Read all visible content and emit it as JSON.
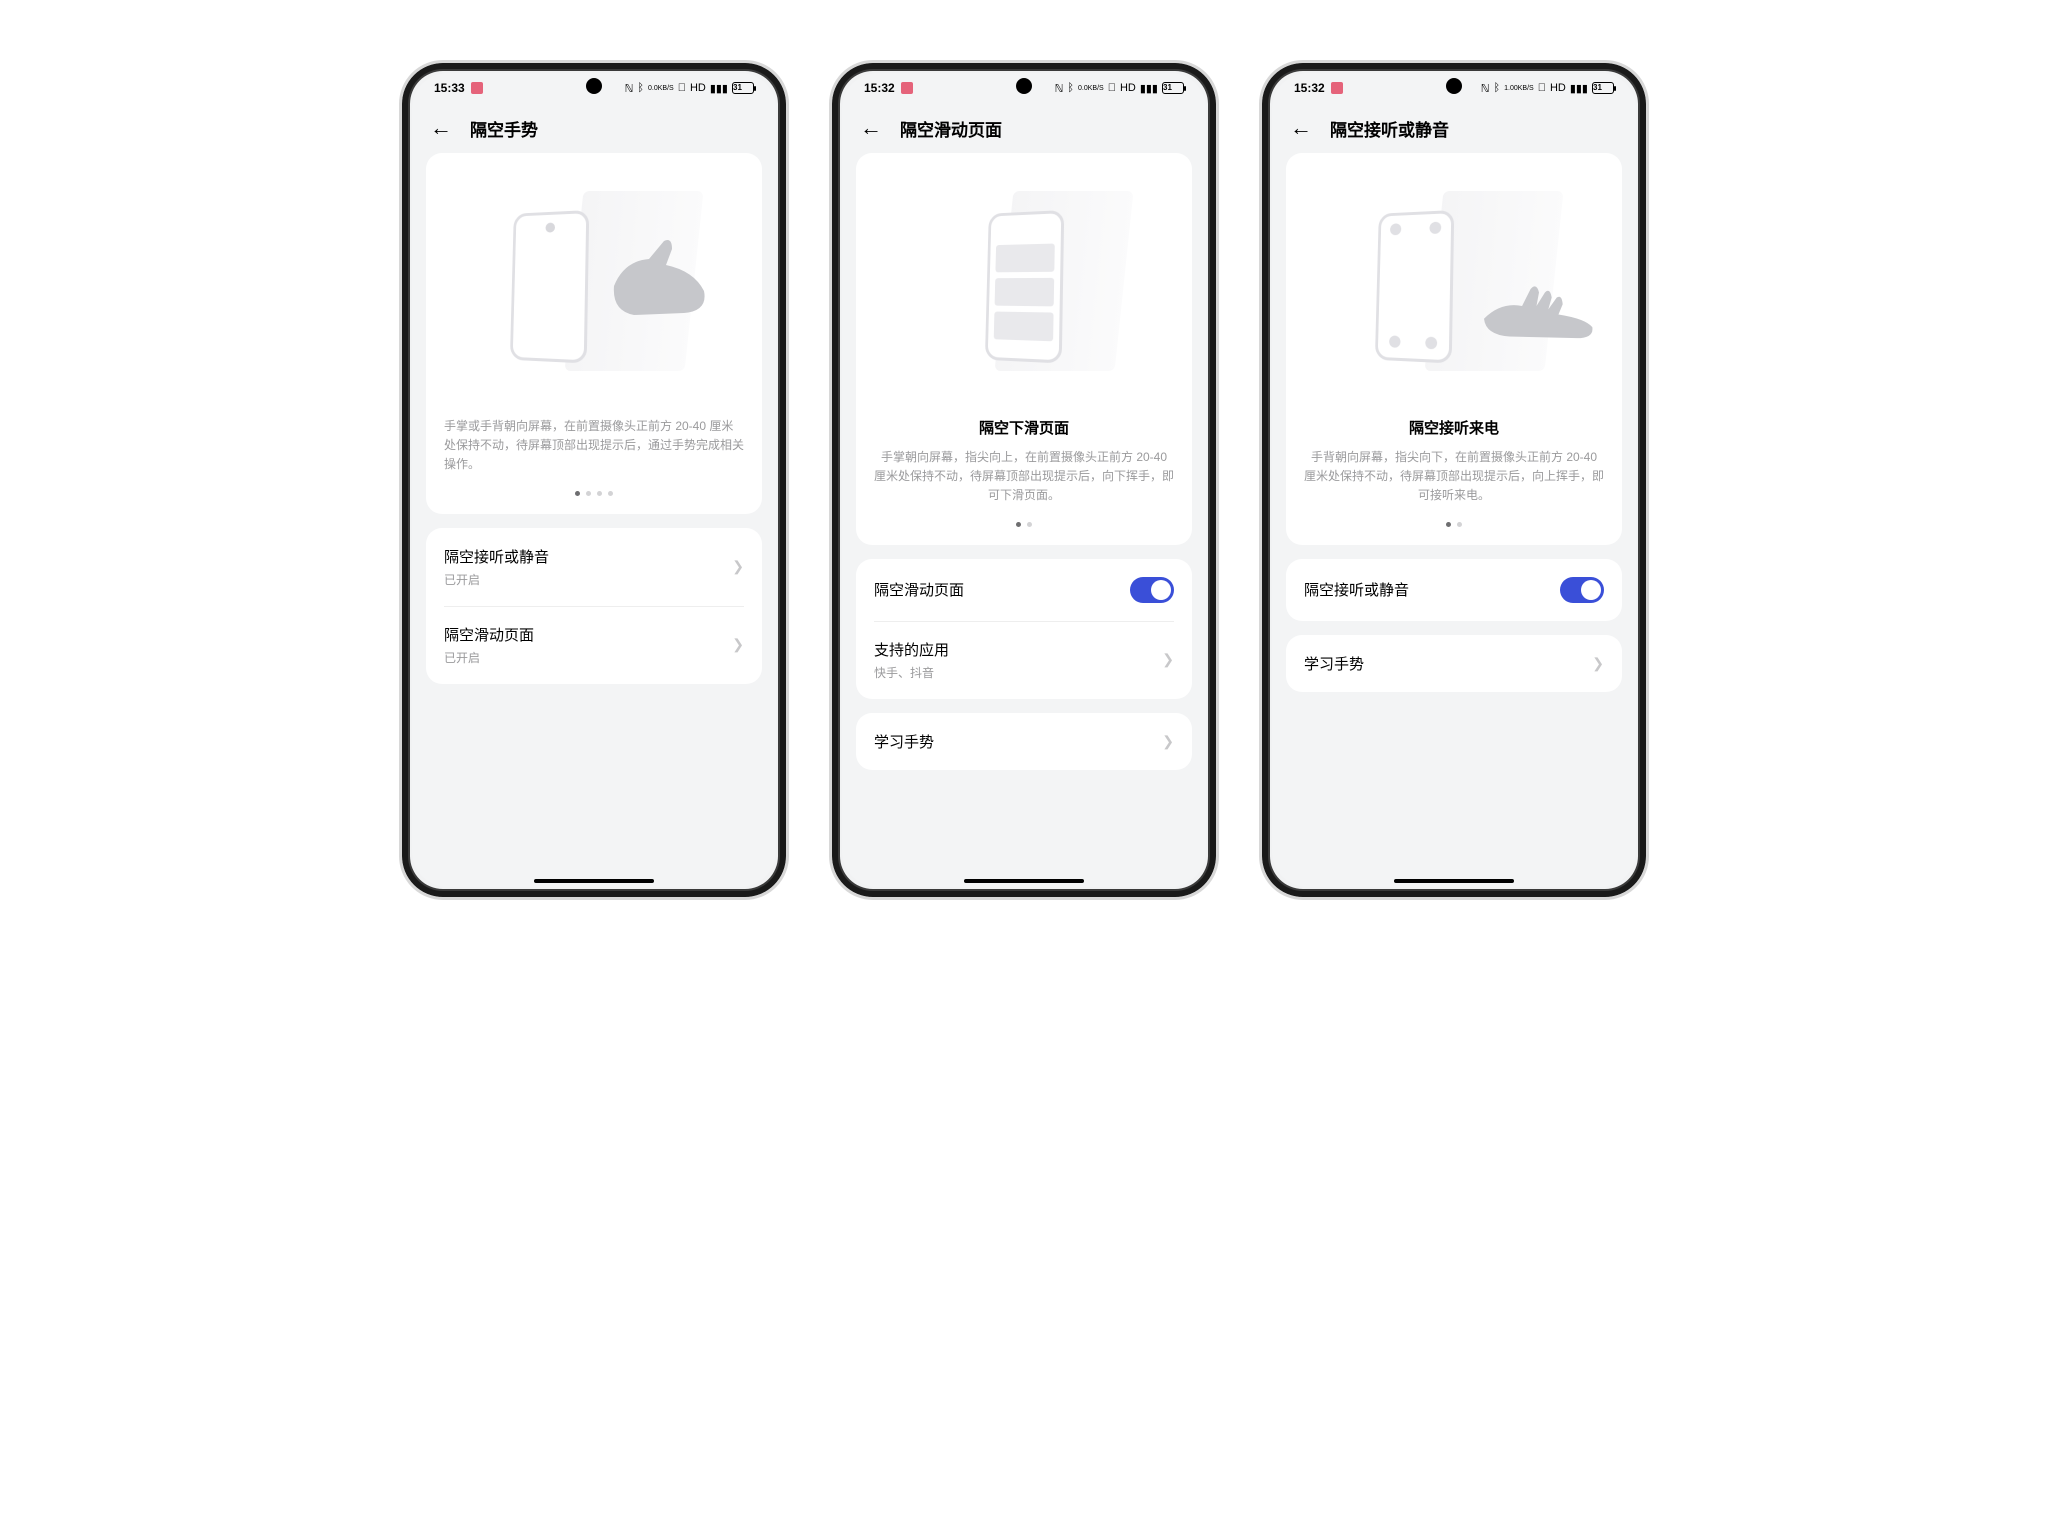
{
  "status": {
    "time1": "15:33",
    "time2": "15:32",
    "time3": "15:32",
    "kbs": "0.0",
    "kbs_unit": "KB/S",
    "battery": "31"
  },
  "phone1": {
    "title": "隔空手势",
    "illus_desc": "手掌或手背朝向屏幕，在前置摄像头正前方 20-40 厘米处保持不动，待屏幕顶部出现提示后，通过手势完成相关操作。",
    "dots_total": 4,
    "dots_active": 0,
    "rows": [
      {
        "title": "隔空接听或静音",
        "sub": "已开启"
      },
      {
        "title": "隔空滑动页面",
        "sub": "已开启"
      }
    ]
  },
  "phone2": {
    "title": "隔空滑动页面",
    "illus_title": "隔空下滑页面",
    "illus_desc": "手掌朝向屏幕，指尖向上，在前置摄像头正前方 20-40 厘米处保持不动，待屏幕顶部出现提示后，向下挥手，即可下滑页面。",
    "dots_total": 2,
    "dots_active": 0,
    "toggle_label": "隔空滑动页面",
    "supported_label": "支持的应用",
    "supported_sub": "快手、抖音",
    "learn_label": "学习手势"
  },
  "phone3": {
    "title": "隔空接听或静音",
    "illus_title": "隔空接听来电",
    "illus_desc": "手背朝向屏幕，指尖向下，在前置摄像头正前方 20-40 厘米处保持不动，待屏幕顶部出现提示后，向上挥手，即可接听来电。",
    "dots_total": 2,
    "dots_active": 0,
    "toggle_label": "隔空接听或静音",
    "learn_label": "学习手势"
  }
}
